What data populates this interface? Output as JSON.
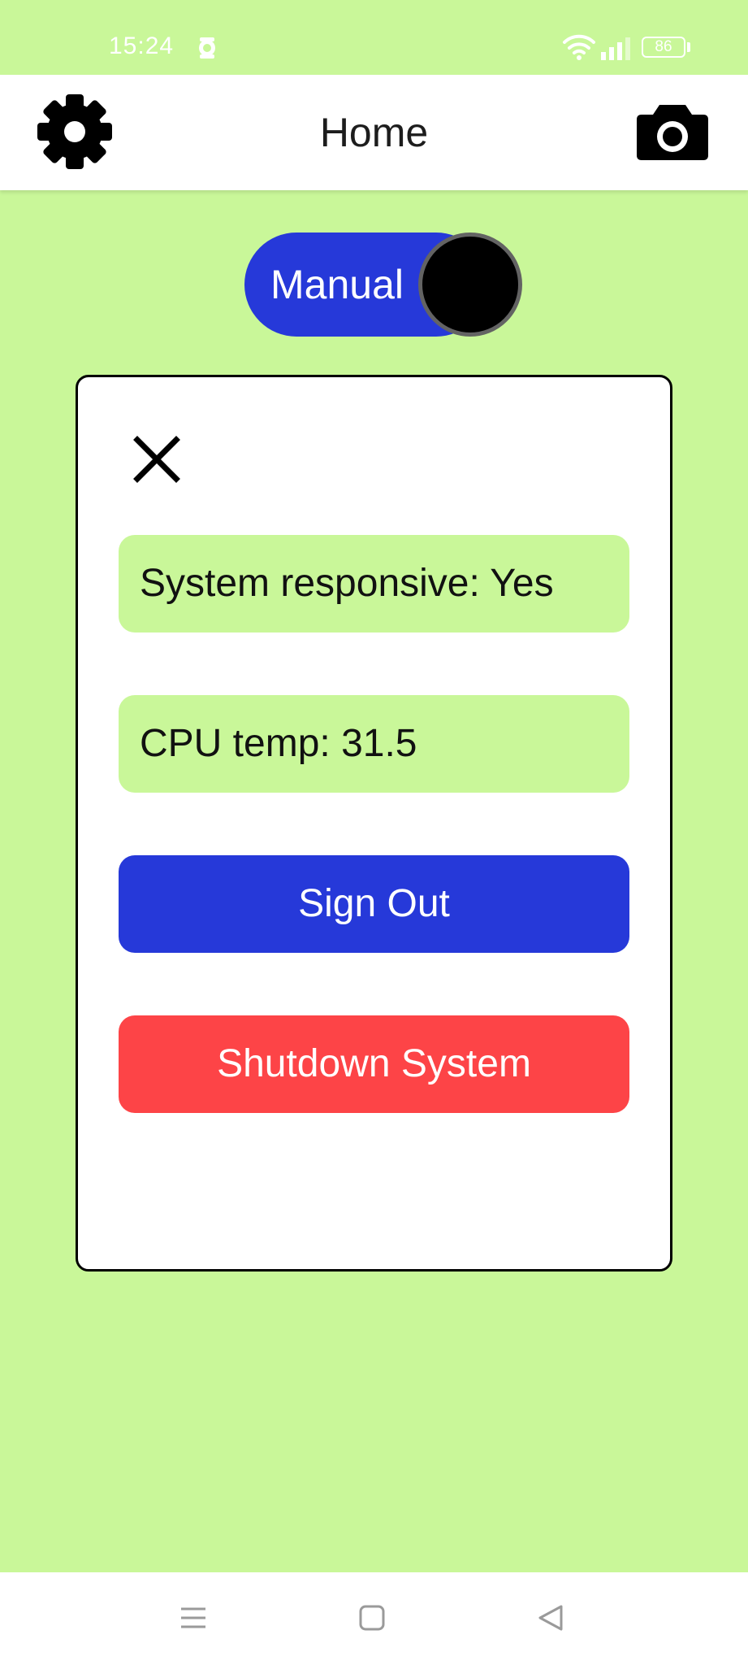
{
  "status_bar": {
    "time": "15:24",
    "battery": "86",
    "icons": [
      "app-notification-icon",
      "wifi-icon",
      "signal-icon",
      "battery-icon"
    ]
  },
  "header": {
    "title": "Home",
    "left_icon": "gear-icon",
    "right_icon": "camera-icon"
  },
  "mode_toggle": {
    "label": "Manual"
  },
  "dialog": {
    "close_icon": "close-icon",
    "system_responsive": "System responsive: Yes",
    "cpu_temp": "CPU temp: 31.5",
    "sign_out_label": "Sign Out",
    "shutdown_label": "Shutdown System"
  },
  "nav_bar": {
    "icons": [
      "menu-icon",
      "home-icon",
      "back-icon"
    ]
  },
  "colors": {
    "background": "#c9f799",
    "primary_blue": "#2639d9",
    "danger_red": "#fd4447",
    "white": "#ffffff",
    "black": "#000000"
  }
}
